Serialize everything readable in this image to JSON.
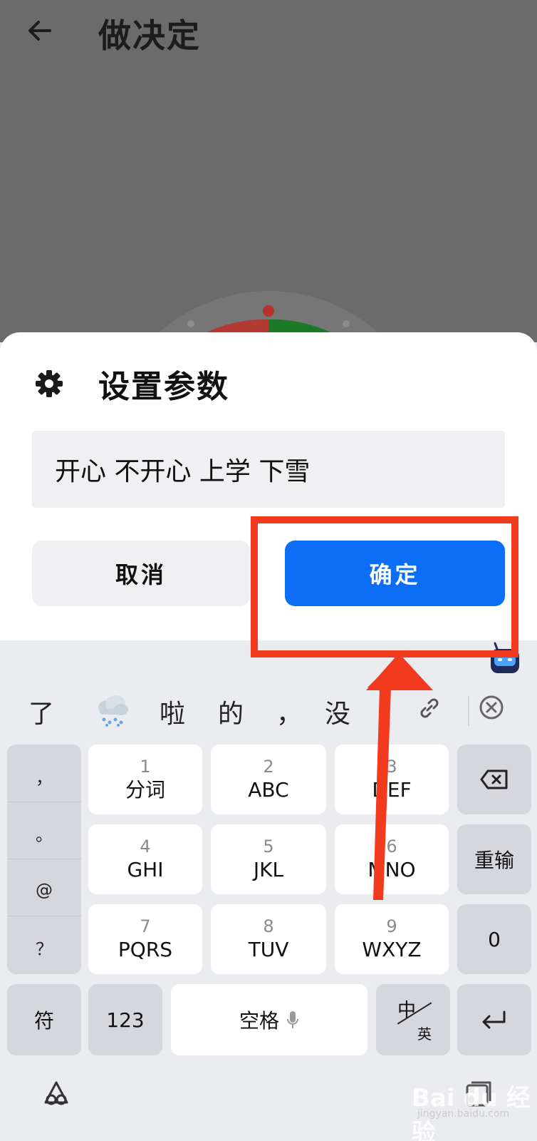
{
  "header": {
    "title": "做决定",
    "back_icon": "arrow-left-icon"
  },
  "wheel": {
    "colors": [
      "#c9392f",
      "#1f8a2a",
      "#8a8a8a"
    ]
  },
  "dialog": {
    "title": "设置参数",
    "icon": "gear-icon",
    "input_value": "开心 不开心 上学 下雪",
    "cancel_label": "取消",
    "confirm_label": "确定"
  },
  "keyboard": {
    "candidates": [
      "了",
      "啦",
      "的",
      "，",
      "没"
    ],
    "candidate_emoji": "snow-cloud-icon",
    "punctuation": [
      "，",
      "。",
      "@",
      "？"
    ],
    "keys": [
      {
        "digit": "1",
        "letters": "分词"
      },
      {
        "digit": "2",
        "letters": "ABC"
      },
      {
        "digit": "3",
        "letters": "DEF"
      },
      {
        "digit": "4",
        "letters": "GHI"
      },
      {
        "digit": "5",
        "letters": "JKL"
      },
      {
        "digit": "6",
        "letters": "MNO"
      },
      {
        "digit": "7",
        "letters": "PQRS"
      },
      {
        "digit": "8",
        "letters": "TUV"
      },
      {
        "digit": "9",
        "letters": "WXYZ"
      }
    ],
    "reinput_label": "重输",
    "zero_label": "0",
    "symbol_label": "符",
    "num_label": "123",
    "space_label": "空格",
    "lang_zh": "中",
    "lang_en": "英"
  },
  "watermark": {
    "text": "Bai du 经验",
    "sub": "jingyan.baidu.com"
  },
  "colors": {
    "accent": "#0b6ef5",
    "annotation": "#f23a1f"
  }
}
